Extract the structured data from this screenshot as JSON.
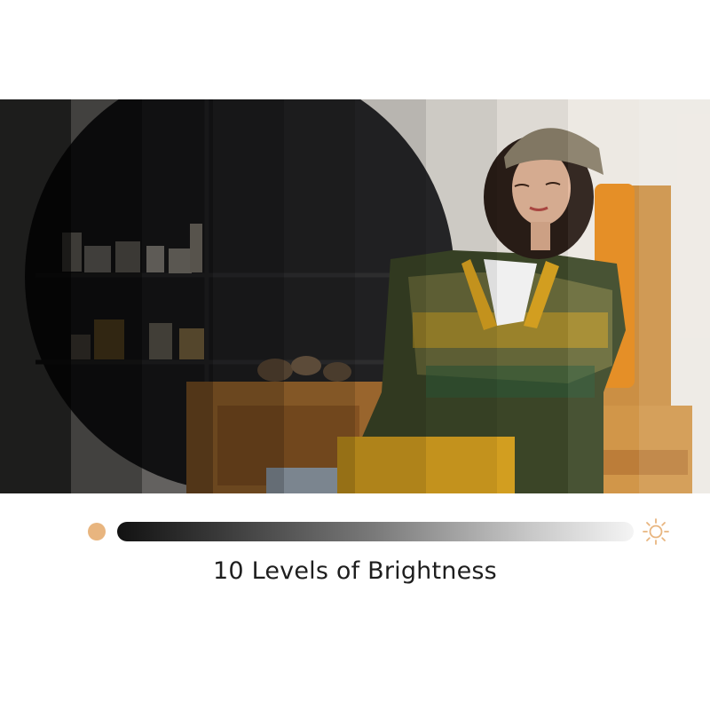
{
  "caption": "10 Levels of Brightness",
  "brightness": {
    "levels": 10,
    "level_overlays": [
      "rgba(0,0,0,0.88)",
      "rgba(0,0,0,0.72)",
      "rgba(0,0,0,0.58)",
      "rgba(0,0,0,0.45)",
      "rgba(0,0,0,0.33)",
      "rgba(0,0,0,0.22)",
      "rgba(0,0,0,0.13)",
      "rgba(0,0,0,0.06)",
      "rgba(255,255,255,0.05)",
      "rgba(255,255,255,0.14)"
    ],
    "low_icon": "dim-dot-icon",
    "high_icon": "sun-icon"
  },
  "photo": {
    "subject": "woman-in-beanie-on-wooden-chair-photo"
  },
  "colors": {
    "accent": "#e8b57f",
    "caption_text": "#1e1e1e",
    "background": "#ffffff"
  }
}
